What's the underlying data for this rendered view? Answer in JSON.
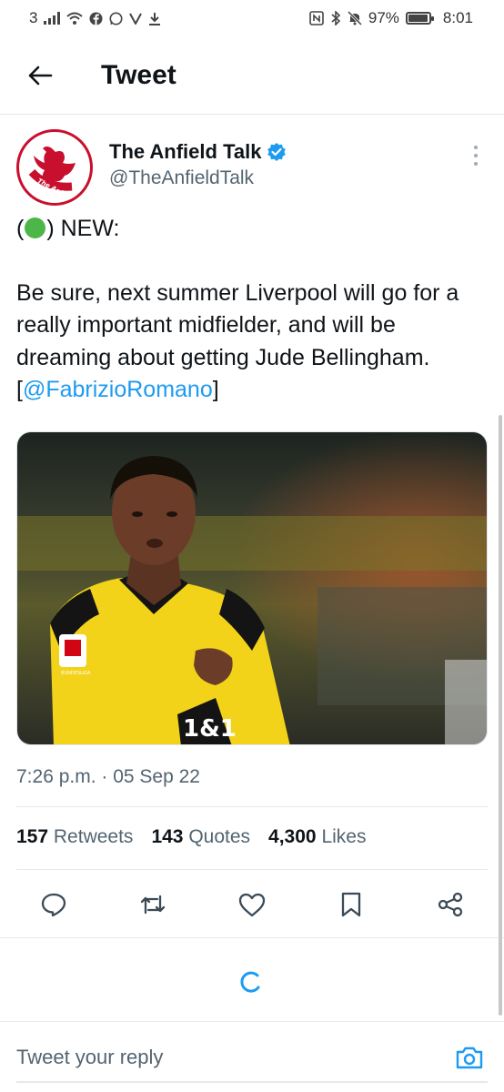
{
  "status_bar": {
    "sim_label": "3",
    "battery_text": "97%",
    "battery_level": 0.97,
    "time": "8:01",
    "left_icons": [
      "signal-icon",
      "wifi-icon",
      "facebook-icon",
      "whatsapp-icon",
      "vpn-icon",
      "download-icon"
    ],
    "right_icons": [
      "nfc-icon",
      "bluetooth-icon",
      "mute-icon",
      "battery-icon"
    ]
  },
  "header": {
    "title": "Tweet",
    "back_icon": "back-arrow-icon"
  },
  "tweet": {
    "author_name": "The Anfield Talk",
    "author_handle": "@TheAnfieldTalk",
    "verified": true,
    "avatar_text": "The Anfield Talk",
    "text_line1_open": "(",
    "text_line1_close": ") NEW:",
    "body": "Be sure, next summer Liverpool will go for a really important midfielder, and will be dreaming about getting Jude Bellingham. [",
    "mention": "@FabrizioRomano",
    "body_end": "]",
    "timestamp": "7:26 p.m. · 05 Sep 22",
    "image_alt": "Jude Bellingham in a yellow and black football kit",
    "image_badge_text": "BUNDESLIGA",
    "shirt_sponsor": "1&1"
  },
  "stats": {
    "retweets_count": "157",
    "retweets_label": "Retweets",
    "quotes_count": "143",
    "quotes_label": "Quotes",
    "likes_count": "4,300",
    "likes_label": "Likes"
  },
  "actions": [
    "reply-icon",
    "retweet-icon",
    "like-icon",
    "bookmark-icon",
    "share-icon"
  ],
  "reply": {
    "placeholder": "Tweet your reply"
  },
  "colors": {
    "accent": "#1d9bf0",
    "text_primary": "#0f1419",
    "text_secondary": "#536471",
    "divider": "#e6e9eb",
    "liverpool_red": "#c8102e",
    "green_emoji": "#4cb648"
  }
}
